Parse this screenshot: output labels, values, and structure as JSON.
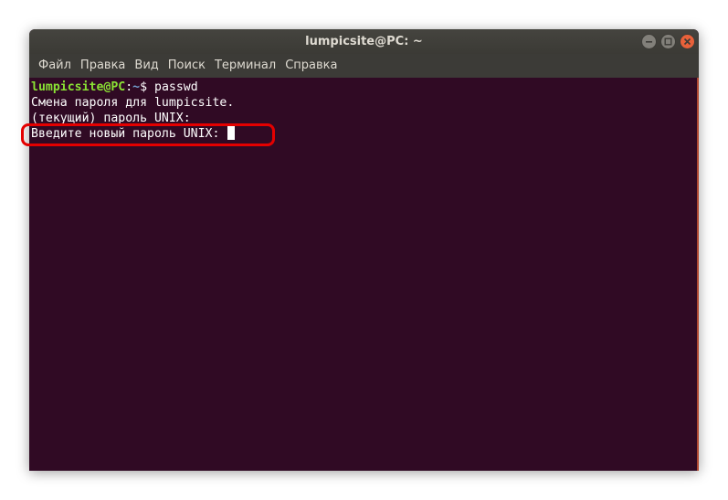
{
  "window": {
    "title": "lumpicsite@PC: ~"
  },
  "menu": {
    "items": [
      "Файл",
      "Правка",
      "Вид",
      "Поиск",
      "Терминал",
      "Справка"
    ]
  },
  "terminal": {
    "prompt_user": "lumpicsite@PC",
    "prompt_sep": ":",
    "prompt_path": "~",
    "prompt_symbol": "$ ",
    "command": "passwd",
    "line2": "Смена пароля для lumpicsite.",
    "line3": "(текущий) пароль UNIX:",
    "line4": "Введите новый пароль UNIX: "
  },
  "icons": {
    "minimize": "minimize-icon",
    "maximize": "maximize-icon",
    "close": "close-icon"
  },
  "colors": {
    "terminal_bg": "#300a24",
    "prompt_user": "#8ae234",
    "prompt_path": "#729fcf",
    "highlight": "#e40000",
    "close_button": "#e8613a"
  }
}
